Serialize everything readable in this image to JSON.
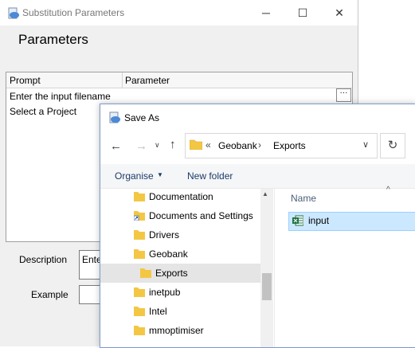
{
  "background_dialog": {
    "title": "Substitution Parameters",
    "heading": "Parameters",
    "table": {
      "columns": [
        "Prompt",
        "Parameter"
      ],
      "rows": [
        {
          "prompt": "Enter the input filename",
          "parameter": ""
        },
        {
          "prompt": "Select a Project",
          "parameter": ""
        }
      ],
      "browse_button": "···"
    },
    "description_label": "Description",
    "description_value": "Ente",
    "example_label": "Example",
    "example_value": "",
    "window_controls": {
      "minimize": "─",
      "maximize": "☐",
      "close": "✕"
    }
  },
  "save_as": {
    "title": "Save As",
    "nav": {
      "back": "←",
      "forward": "→",
      "recent": "∨",
      "up": "↑"
    },
    "address": {
      "chevron": "«",
      "segments": [
        "Geobank",
        "Exports"
      ],
      "separator": "›",
      "dropdown": "∨"
    },
    "refresh": "↻",
    "toolbar": {
      "organise": "Organise",
      "organise_caret": "▼",
      "new_folder": "New folder"
    },
    "tree": [
      {
        "label": "Documentation",
        "selected": false,
        "indent": 1,
        "icon": "folder-icon"
      },
      {
        "label": "Documents and Settings",
        "selected": false,
        "indent": 1,
        "icon": "shortcut-folder-icon"
      },
      {
        "label": "Drivers",
        "selected": false,
        "indent": 1,
        "icon": "folder-icon"
      },
      {
        "label": "Geobank",
        "selected": false,
        "indent": 1,
        "icon": "folder-icon"
      },
      {
        "label": "Exports",
        "selected": true,
        "indent": 2,
        "icon": "folder-icon"
      },
      {
        "label": "inetpub",
        "selected": false,
        "indent": 1,
        "icon": "folder-icon"
      },
      {
        "label": "Intel",
        "selected": false,
        "indent": 1,
        "icon": "folder-icon"
      },
      {
        "label": "mmoptimiser",
        "selected": false,
        "indent": 1,
        "icon": "folder-icon"
      }
    ],
    "files": {
      "column_name": "Name",
      "sort_indicator": "^",
      "items": [
        {
          "name": "input",
          "icon": "excel-icon",
          "selected": true
        }
      ]
    }
  },
  "colors": {
    "folder": "#f3c744",
    "selection": "#cce8ff",
    "accent": "#1a3b6b",
    "excel": "#1f7244"
  }
}
